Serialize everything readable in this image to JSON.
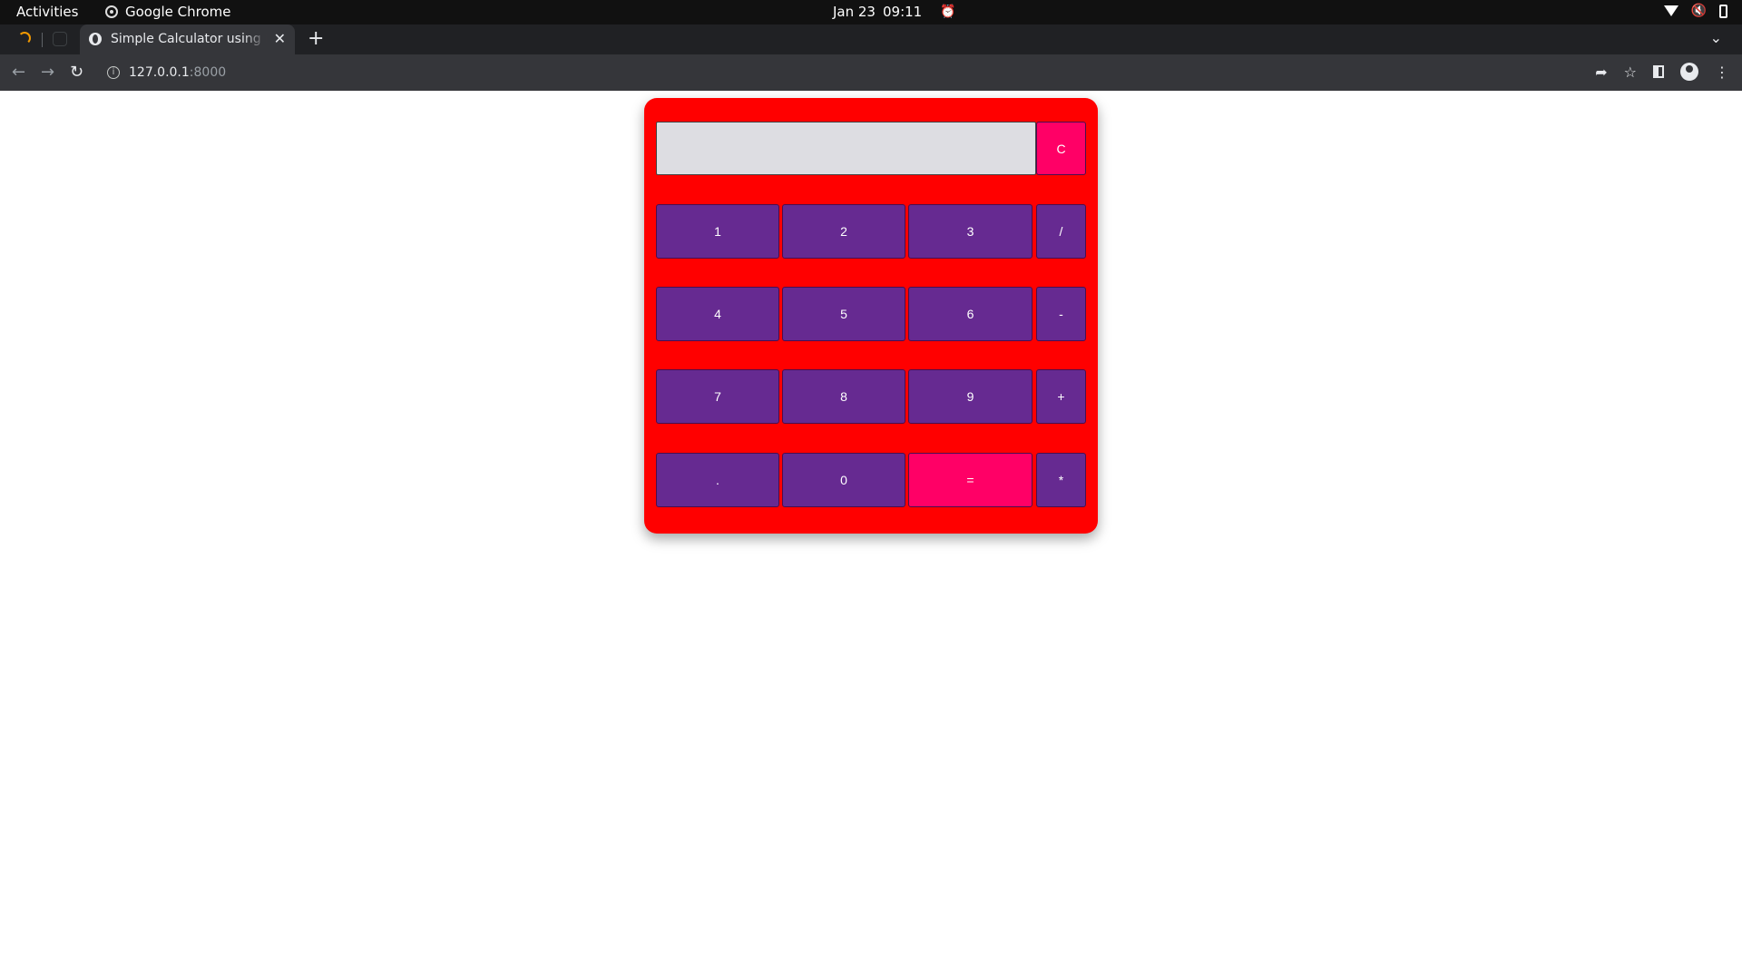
{
  "system_bar": {
    "activities": "Activities",
    "app_name": "Google Chrome",
    "date": "Jan 23",
    "time": "09:11"
  },
  "browser": {
    "tab_title": "Simple Calculator using HTML",
    "url_host": "127.0.0.1",
    "url_port": ":8000"
  },
  "calculator": {
    "display_value": "",
    "colors": {
      "body": "#ff0000",
      "button": "#662a91",
      "accent_button": "#ff0066",
      "display": "#dddde2"
    },
    "clear_label": "C",
    "rows": [
      [
        "1",
        "2",
        "3",
        "/"
      ],
      [
        "4",
        "5",
        "6",
        "-"
      ],
      [
        "7",
        "8",
        "9",
        "+"
      ],
      [
        ".",
        "0",
        "=",
        "*"
      ]
    ]
  }
}
